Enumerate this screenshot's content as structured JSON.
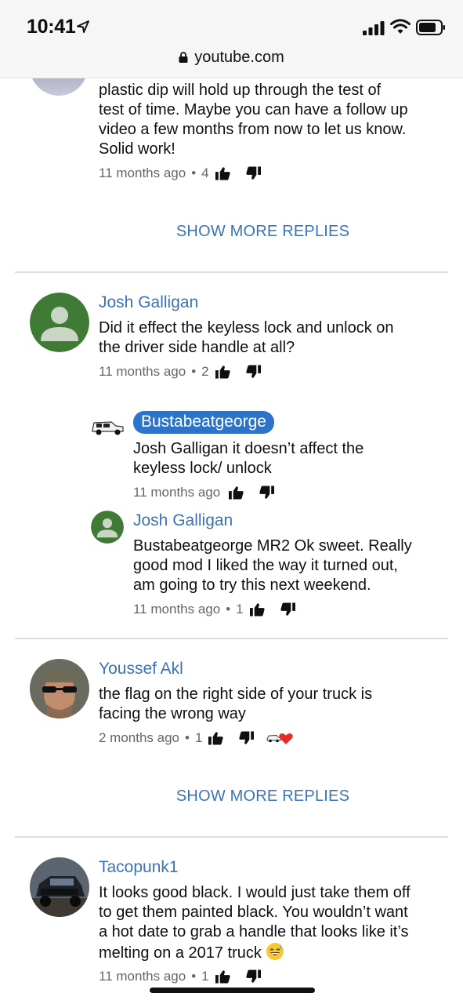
{
  "status_bar": {
    "time": "10:41",
    "url": "youtube.com"
  },
  "comments": [
    {
      "text_lines": [
        "plastic dip will hold up through the test of",
        "test of time. Maybe you can have a follow up",
        "video a few months from now to let us know.",
        "Solid work!"
      ],
      "time_ago": "11 months ago",
      "likes": "4"
    },
    {
      "author": "Josh Galligan",
      "text_lines": [
        "Did it effect the keyless lock and unlock on",
        "the driver side handle at all?"
      ],
      "time_ago": "11 months ago",
      "likes": "2",
      "replies": [
        {
          "author": "Bustabeatgeorge",
          "text_lines": [
            "Josh Galligan it doesn’t affect the",
            "keyless lock/ unlock"
          ],
          "time_ago": "11 months ago"
        },
        {
          "author": "Josh Galligan",
          "text_lines": [
            "Bustabeatgeorge MR2 Ok sweet. Really",
            "good mod I liked the way it turned out,",
            "am going to try this next weekend."
          ],
          "time_ago": "11 months ago",
          "likes": "1"
        }
      ]
    },
    {
      "author": "Youssef Akl",
      "text_lines": [
        "the flag on the right side of your truck is",
        "facing the wrong way"
      ],
      "time_ago": "2 months ago",
      "likes": "1"
    },
    {
      "author": "Tacopunk1",
      "text_lines": [
        "It looks good black. I would just take them off",
        "to get them painted black. You wouldn’t want",
        "a hot date to grab a handle that looks like it’s",
        "melting on a 2017 truck"
      ],
      "time_ago": "11 months ago",
      "likes": "1"
    }
  ],
  "show_more_replies_label": "SHOW MORE REPLIES",
  "meta_separator": "•",
  "colors": {
    "link": "#3a73b8",
    "chip": "#2c73c9",
    "muted": "#666666",
    "divider": "#dedede"
  },
  "icons": [
    "location-arrow-icon",
    "signal-icon",
    "wifi-icon",
    "battery-icon",
    "lock-icon",
    "thumbs-up-icon",
    "thumbs-down-icon",
    "creator-heart-icon",
    "grinning-sweat-emoji"
  ]
}
